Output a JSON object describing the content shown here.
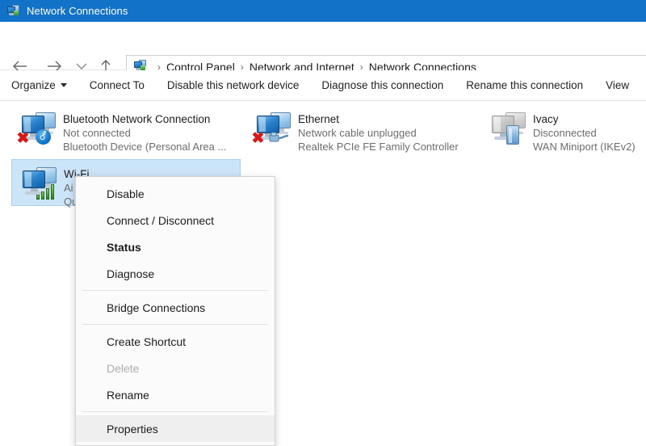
{
  "window": {
    "title": "Network Connections",
    "icon": "network-connections-icon",
    "titlebar_color": "#1272c8"
  },
  "navigation": {
    "back": "back-arrow",
    "forward": "forward-arrow",
    "recent": "recent-locations-chevron",
    "up": "up-arrow",
    "address": {
      "icon": "network-connections-icon",
      "separator": "›",
      "crumbs": [
        "Control Panel",
        "Network and Internet",
        "Network Connections"
      ]
    }
  },
  "toolbar": {
    "items": [
      {
        "label": "Organize",
        "has_caret": true
      },
      {
        "label": "Connect To",
        "has_caret": false
      },
      {
        "label": "Disable this network device",
        "has_caret": false
      },
      {
        "label": "Diagnose this connection",
        "has_caret": false
      },
      {
        "label": "Rename this connection",
        "has_caret": false
      },
      {
        "label": "View",
        "has_caret": false
      }
    ]
  },
  "connections": [
    {
      "name": "Bluetooth Network Connection",
      "status": "Not connected",
      "device": "Bluetooth Device (Personal Area ...",
      "icon": "network-adapter-bluetooth-icon",
      "selected": false
    },
    {
      "name": "Ethernet",
      "status": "Network cable unplugged",
      "device": "Realtek PCIe FE Family Controller",
      "icon": "network-adapter-ethernet-icon",
      "selected": false
    },
    {
      "name": "Ivacy",
      "status": "Disconnected",
      "device": "WAN Miniport (IKEv2)",
      "icon": "network-adapter-vpn-icon",
      "selected": false
    },
    {
      "name": "Wi-Fi",
      "status": "Ai",
      "device": "Qu",
      "icon": "network-adapter-wifi-icon",
      "selected": true
    }
  ],
  "context_menu": {
    "items": [
      {
        "label": "Disable",
        "shield": true,
        "bold": false,
        "disabled": false,
        "hover": false
      },
      {
        "label": "Connect / Disconnect",
        "shield": false,
        "bold": false,
        "disabled": false,
        "hover": false
      },
      {
        "label": "Status",
        "shield": false,
        "bold": true,
        "disabled": false,
        "hover": false
      },
      {
        "label": "Diagnose",
        "shield": false,
        "bold": false,
        "disabled": false,
        "hover": false
      },
      {
        "separator": true
      },
      {
        "label": "Bridge Connections",
        "shield": true,
        "bold": false,
        "disabled": false,
        "hover": false
      },
      {
        "separator": true
      },
      {
        "label": "Create Shortcut",
        "shield": false,
        "bold": false,
        "disabled": false,
        "hover": false
      },
      {
        "label": "Delete",
        "shield": true,
        "bold": false,
        "disabled": true,
        "hover": false
      },
      {
        "label": "Rename",
        "shield": true,
        "bold": false,
        "disabled": false,
        "hover": false
      },
      {
        "separator": true
      },
      {
        "label": "Properties",
        "shield": true,
        "bold": false,
        "disabled": false,
        "hover": true
      }
    ]
  },
  "colors": {
    "selection": "#cce4f7",
    "selection_border": "#a9d2f0",
    "menu_hover": "#efefef",
    "title_bar": "#1272c8"
  }
}
